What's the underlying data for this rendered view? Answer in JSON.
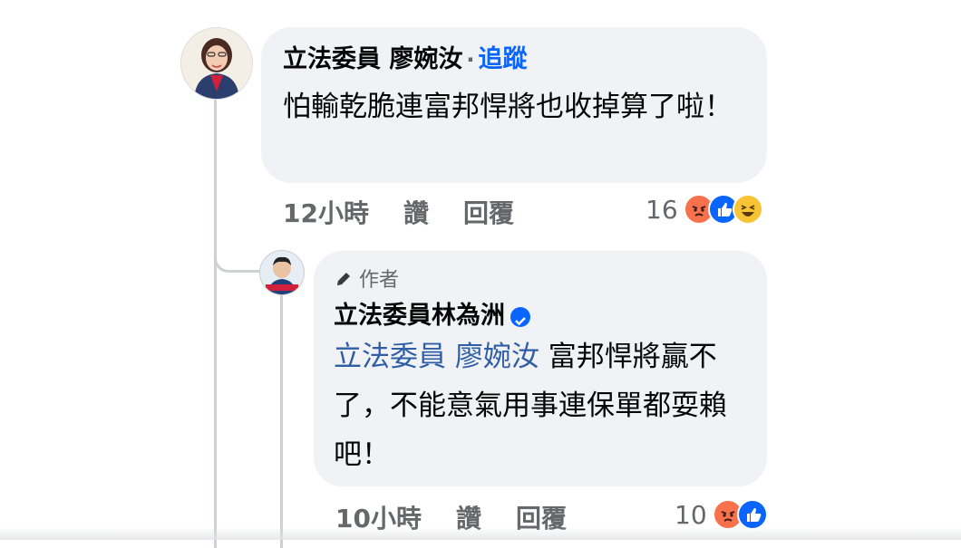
{
  "comment1": {
    "author": "立法委員 廖婉汝",
    "separator": "·",
    "follow_label": "追蹤",
    "text": "怕輸乾脆連富邦悍將也收掉算了啦！",
    "time": "12小時",
    "like_label": "讚",
    "reply_label": "回覆",
    "reaction_count": "16",
    "reactions": [
      "angry-icon",
      "like-icon",
      "haha-icon"
    ]
  },
  "comment2": {
    "author_badge_label": "作者",
    "author": "立法委員林為洲",
    "mention": "立法委員 廖婉汝",
    "text": " 富邦悍將贏不了，不能意氣用事連保單都耍賴吧！",
    "time": "10小時",
    "like_label": "讚",
    "reply_label": "回覆",
    "reaction_count": "10",
    "reactions": [
      "angry-icon",
      "like-icon"
    ]
  },
  "colors": {
    "bubble": "#f0f2f5",
    "link": "#0866ff",
    "mention": "#2f5ea7",
    "meta": "#65676b",
    "line": "#ced0d4"
  }
}
